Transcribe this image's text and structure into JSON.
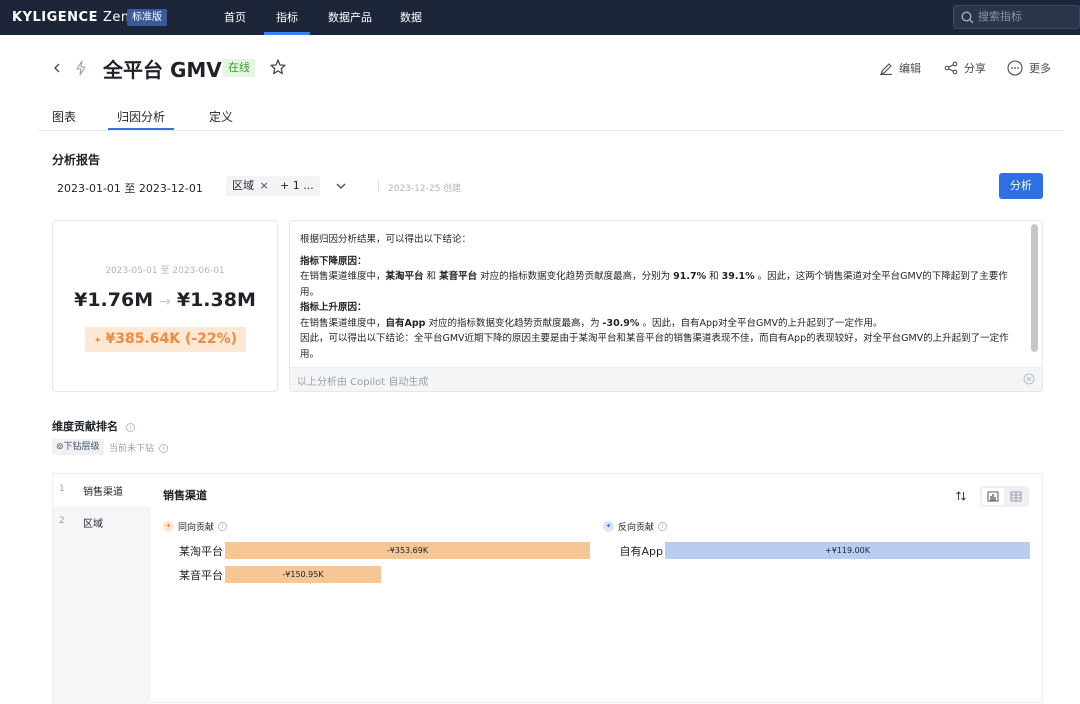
{
  "topbar": {
    "brand": "KYLIGENCE",
    "brand_suffix": "Zen",
    "edition": "标准版",
    "nav": [
      "首页",
      "指标",
      "数据产品",
      "数据"
    ],
    "active_nav": "指标",
    "search_placeholder": "搜索指标"
  },
  "header": {
    "title": "全平台 GMV",
    "status": "在线",
    "actions": {
      "edit": "编辑",
      "share": "分享",
      "more": "更多"
    }
  },
  "tabs": [
    "图表",
    "归因分析",
    "定义"
  ],
  "active_tab": "归因分析",
  "report": {
    "section_title": "分析报告",
    "date_range": "2023-01-01 至 2023-12-01",
    "filter_chip": "区域",
    "filter_chip_close": "×",
    "more_chip": "+ 1 ...",
    "created": "2023-12-25 创建",
    "analyze_button": "分析"
  },
  "metric": {
    "period": "2023-05-01 至 2023-06-01",
    "from_value": "¥1.76M",
    "to_value": "¥1.38M",
    "delta": "¥385.64K (-22%)"
  },
  "insight": {
    "intro": "根据归因分析结果，可以得出以下结论：",
    "down_title": "指标下降原因：",
    "down_text": {
      "p1": "在销售渠道维度中，",
      "b1": "某淘平台",
      "p2": " 和 ",
      "b2": "某音平台",
      "p3": " 对应的指标数据变化趋势贡献度最高，分别为 ",
      "b3": "91.7%",
      "p4": " 和 ",
      "b4": "39.1%",
      "p5": " 。因此，这两个销售渠道对全平台GMV的下降起到了主要作用。"
    },
    "up_title": "指标上升原因：",
    "up_text": {
      "p1": "在销售渠道维度中，",
      "b1": "自有App",
      "p2": " 对应的指标数据变化趋势贡献度最高，为 ",
      "b2": "-30.9%",
      "p3": " 。因此，自有App对全平台GMV的上升起到了一定作用。"
    },
    "conclusion": "因此，可以得出以下结论：全平台GMV近期下降的原因主要是由于某淘平台和某音平台的销售渠道表现不佳，而自有App的表现较好，对全平台GMV的上升起到了一定作用。",
    "footer": "以上分析由 Copilot 自动生成"
  },
  "contribution": {
    "title": "维度贡献排名",
    "drill_chip": "下钻层级",
    "not_drilled": "当前未下钻",
    "dimensions": [
      {
        "index": "1",
        "label": "销售渠道"
      },
      {
        "index": "2",
        "label": "区域"
      }
    ],
    "chart_title": "销售渠道",
    "positive_legend": "同向贡献",
    "negative_legend": "反向贡献"
  },
  "chart_data": {
    "type": "bar",
    "title": "销售渠道",
    "groups": [
      {
        "name": "同向贡献",
        "color": "#f6c694",
        "categories": [
          "某淘平台",
          "某音平台"
        ],
        "values": [
          -353.69,
          -150.95
        ],
        "labels": [
          "-¥353.69K",
          "-¥150.95K"
        ],
        "unit": "K"
      },
      {
        "name": "反向贡献",
        "color": "#b9cdf3",
        "categories": [
          "自有App"
        ],
        "values": [
          119.0
        ],
        "labels": [
          "+¥119.00K"
        ],
        "unit": "K"
      }
    ]
  }
}
